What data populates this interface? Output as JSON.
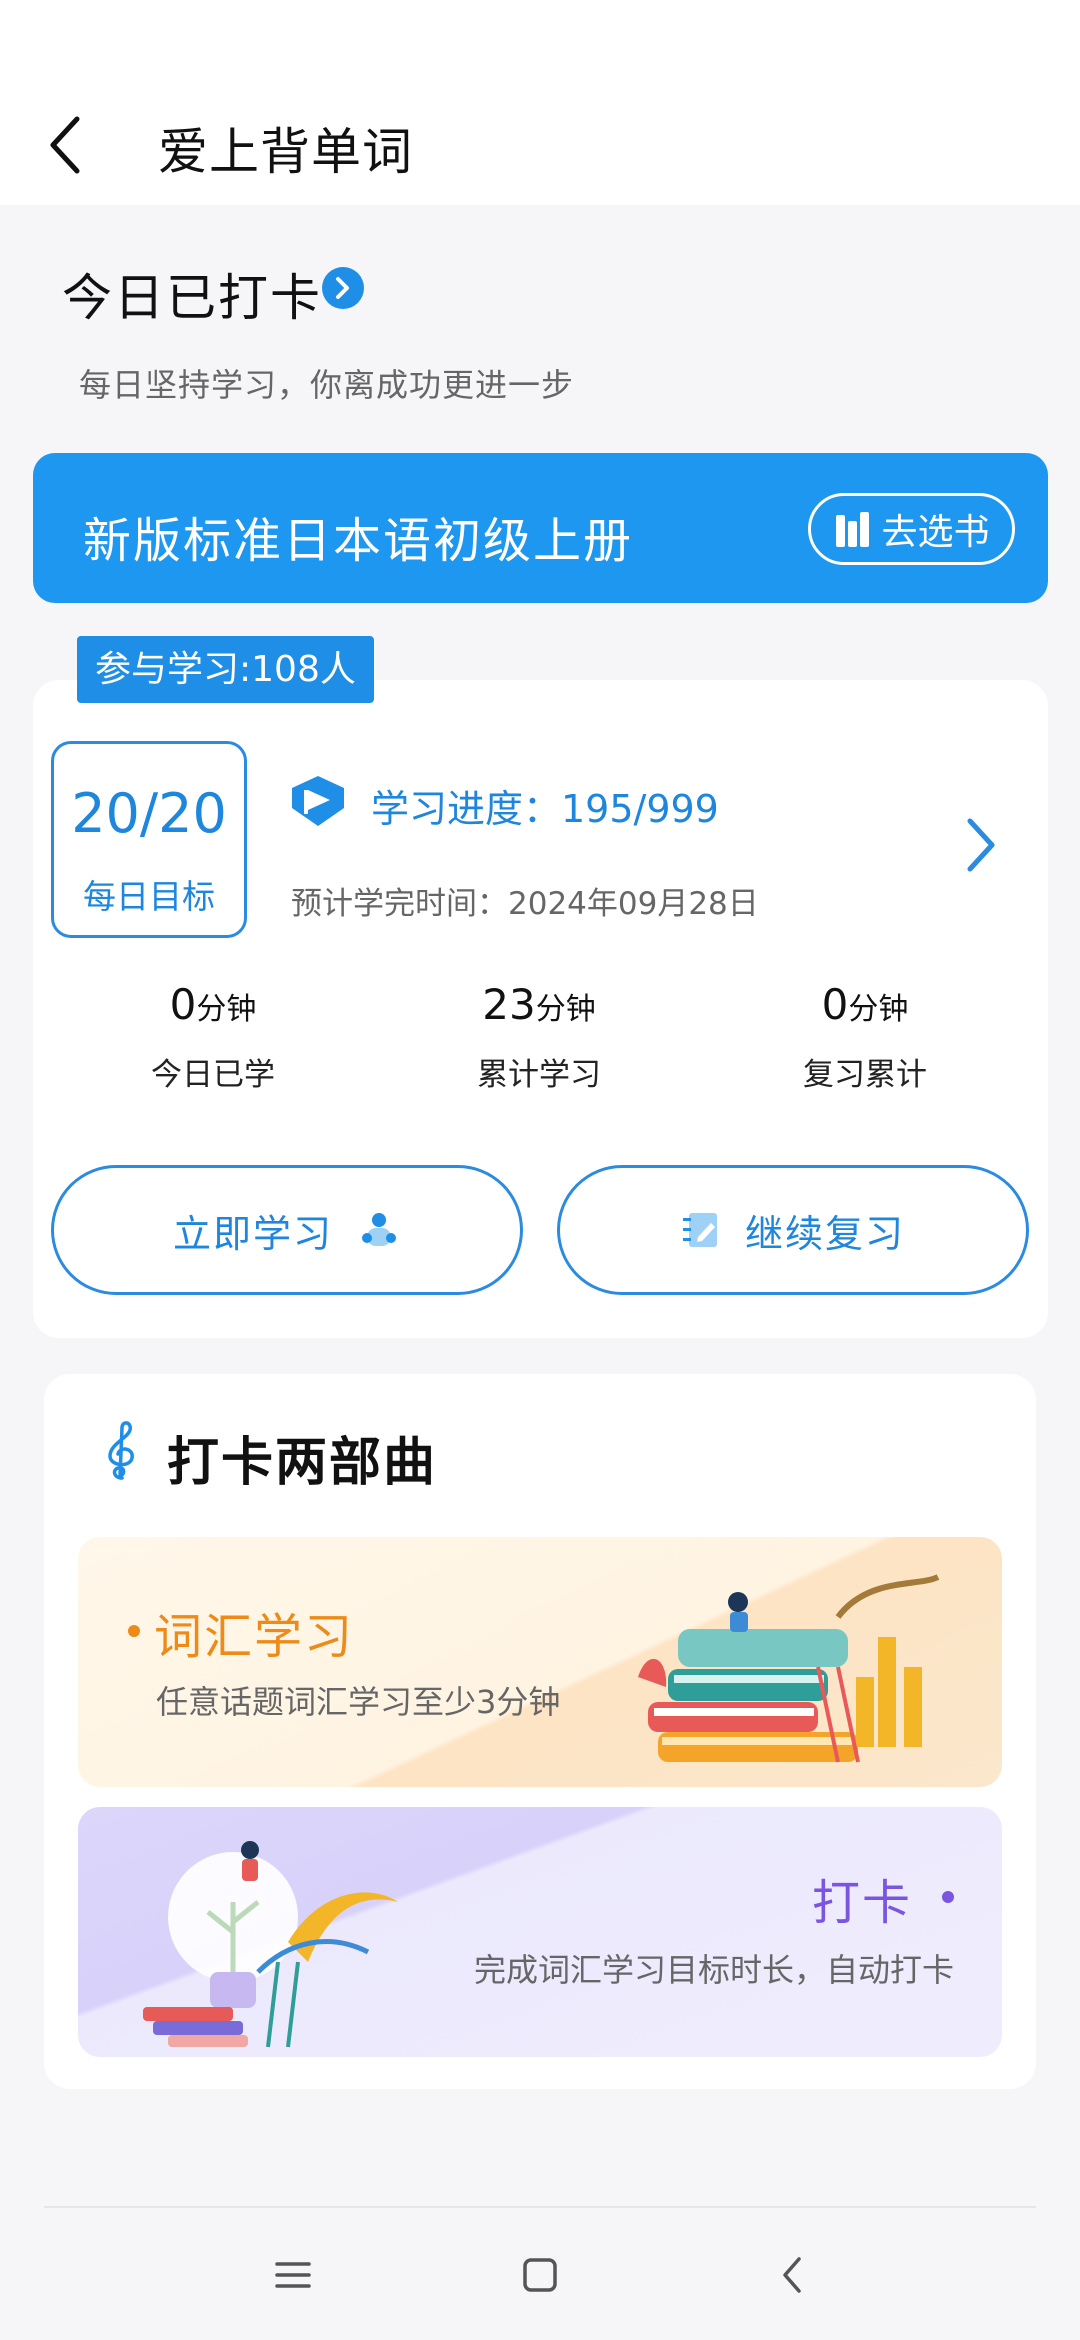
{
  "header": {
    "title": "爱上背单词"
  },
  "checkin": {
    "title": "今日已打卡",
    "subtitle": "每日坚持学习，你离成功更进一步"
  },
  "book": {
    "name": "新版标准日本语初级上册",
    "choose_label": "去选书"
  },
  "study": {
    "participants": "参与学习:108人",
    "goal_value": "20/20",
    "goal_label": "每日目标",
    "progress": "学习进度：195/999",
    "finish_time": "预计学完时间：2024年09月28日",
    "stats": [
      {
        "value": "0",
        "unit": "分钟",
        "label": "今日已学"
      },
      {
        "value": "23",
        "unit": "分钟",
        "label": "累计学习"
      },
      {
        "value": "0",
        "unit": "分钟",
        "label": "复习累计"
      }
    ],
    "study_now_label": "立即学习",
    "review_label": "继续复习"
  },
  "steps": {
    "title": "打卡两部曲",
    "vocab_title": "词汇学习",
    "vocab_desc": "任意话题词汇学习至少3分钟",
    "checkin_title": "打卡",
    "checkin_desc": "完成词汇学习目标时长，自动打卡"
  },
  "colors": {
    "primary": "#1e8ee6",
    "vocab_accent": "#ee8a17",
    "checkin_accent": "#7955e0"
  }
}
